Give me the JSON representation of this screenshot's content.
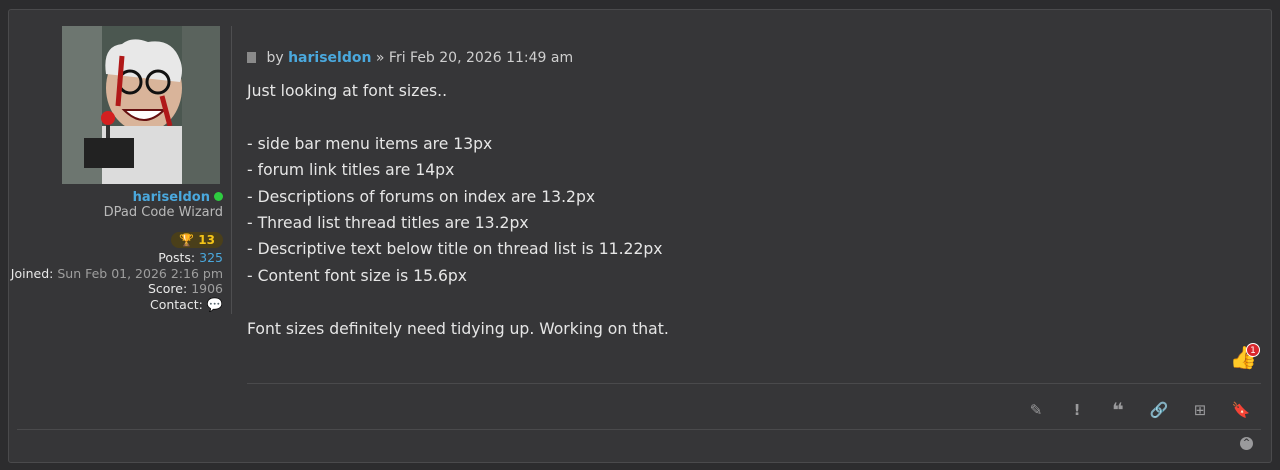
{
  "profile": {
    "username": "hariseldon",
    "rank": "DPad Code Wizard",
    "trophies": "13",
    "posts_label": "Posts:",
    "posts": "325",
    "joined_label": "Joined:",
    "joined": "Sun Feb 01, 2026 2:16 pm",
    "score_label": "Score:",
    "score": "1906",
    "contact_label": "Contact:"
  },
  "post": {
    "by": "by",
    "author": "hariseldon",
    "date": "» Fri Feb 20, 2026 11:49 am",
    "content": "Just looking at font sizes..\n\n- side bar menu items are 13px\n- forum link titles are 14px\n- Descriptions of forums on index are 13.2px\n- Thread list thread titles are 13.2px\n- Descriptive text below title on thread list is 11.22px\n- Content font size is 15.6px\n\nFont sizes definitely need tidying up. Working on that.",
    "reaction_count": "1"
  },
  "icons": {
    "actions": [
      "pencil-icon",
      "exclamation-icon",
      "quote-icon",
      "link-icon",
      "plus-box-icon",
      "bookmark-icon"
    ]
  }
}
